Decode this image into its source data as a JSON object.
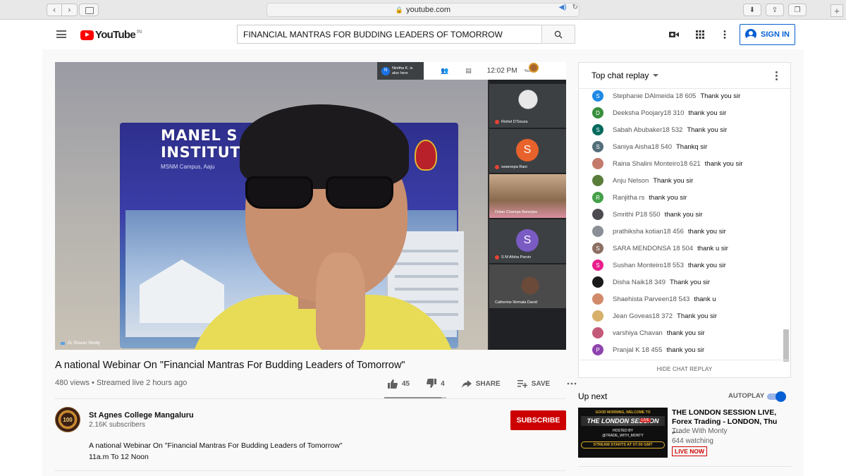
{
  "browser": {
    "url": "youtube.com"
  },
  "header": {
    "logo_text": "YouTube",
    "logo_country": "IN",
    "search_value": "FINANCIAL MANTRAS FOR BUDDING LEADERS OF TOMORROW",
    "signin_label": "SIGN IN"
  },
  "player": {
    "banner_line1": "MANEL S",
    "banner_line2": "INSTITUTE",
    "banner_sub": "MSNM Campus, Aaju",
    "speaker_name": "Dr Sharan Shetty",
    "meet": {
      "presence_initial": "N",
      "presence_text": "Ninitha K. is also here",
      "time": "12:02 PM",
      "you_label": "You"
    },
    "tiles": [
      {
        "name": "Rishel D'Souza",
        "initial": "",
        "color": ""
      },
      {
        "name": "swaroopa Rani",
        "initial": "S",
        "color": "#e8622c"
      },
      {
        "name": "Dolan Champa Banerjee",
        "initial": "",
        "color": ""
      },
      {
        "name": "S M Afsha Parvin",
        "initial": "S",
        "color": "#7a5bc4"
      },
      {
        "name": "Catherine Nirmala David",
        "initial": "",
        "color": ""
      }
    ]
  },
  "video": {
    "title": "A national Webinar On \"Financial Mantras For Budding Leaders of Tomorrow\"",
    "meta": "480 views • Streamed live 2 hours ago",
    "likes": "45",
    "dislikes": "4",
    "share_label": "SHARE",
    "save_label": "SAVE",
    "like_ratio": 0.92
  },
  "channel": {
    "name": "St Agnes College Mangaluru",
    "subscribers": "2.16K subscribers",
    "avatar_text": "100",
    "subscribe_label": "SUBSCRIBE",
    "description_line1": "A national Webinar On \"Financial Mantras For Budding Leaders of Tomorrow\"",
    "description_line2": "11a.m To 12 Noon"
  },
  "chat": {
    "header": "Top chat replay",
    "hide_label": "HIDE CHAT REPLAY",
    "messages": [
      {
        "initial": "S",
        "color": "#1e88e5",
        "author": "Stephanie DAlmeida 18 605",
        "text": "Thank you sir"
      },
      {
        "initial": "D",
        "color": "#388e3c",
        "author": "Deeksha Poojary18 310",
        "text": "thank you sir"
      },
      {
        "initial": "S",
        "color": "#00695c",
        "author": "Sabah Abubaker18 532",
        "text": "Thank you sir"
      },
      {
        "initial": "S",
        "color": "#546e7a",
        "author": "Saniya Aisha18 540",
        "text": "Thankq sir"
      },
      {
        "initial": "",
        "color": "#c47a6b",
        "author": "Raina Shalini Monteiro18 621",
        "text": "thank you sir"
      },
      {
        "initial": "",
        "color": "#5b7d3a",
        "author": "Anju Nelson",
        "text": "Thank you sir"
      },
      {
        "initial": "R",
        "color": "#43a047",
        "author": "Ranjitha rs",
        "text": "thank you sir"
      },
      {
        "initial": "",
        "color": "#4e4a52",
        "author": "Smrithi P18 550",
        "text": "thank you sir"
      },
      {
        "initial": "",
        "color": "#8a8f96",
        "author": "prathiksha kotian18 456",
        "text": "thank you sir"
      },
      {
        "initial": "S",
        "color": "#8d6e63",
        "author": "SARA MENDONSA 18 504",
        "text": "thank u sir"
      },
      {
        "initial": "S",
        "color": "#e91e8c",
        "author": "Sushan Monteiro18 553",
        "text": "thank you sir"
      },
      {
        "initial": "",
        "color": "#1a1a1a",
        "author": "Disha Naik18 349",
        "text": "Thank you sir"
      },
      {
        "initial": "",
        "color": "#d18a6a",
        "author": "Shaehista Parveen18 543",
        "text": "thank u"
      },
      {
        "initial": "",
        "color": "#d7b06a",
        "author": "Jean Goveas18 372",
        "text": "Thank you sir"
      },
      {
        "initial": "",
        "color": "#c45a7a",
        "author": "varshiya Chavan",
        "text": "thank you sir"
      },
      {
        "initial": "P",
        "color": "#8e44ad",
        "author": "Pranjal K 18 455",
        "text": "thank you sir"
      }
    ]
  },
  "upnext": {
    "label": "Up next",
    "autoplay_label": "AUTOPLAY",
    "video_title": "THE LONDON SESSION LIVE, Forex Trading - LONDON, Thu ,...",
    "channel": "Trade With Monty",
    "watching": "644 watching",
    "live_label": "LIVE NOW",
    "thumb_line1": "GOOD MORNING, WELCOME TO",
    "thumb_line2": "THE LONDON SESSION",
    "thumb_line3": "HOSTED BY",
    "thumb_line4": "@TRADE_WITH_MONTY",
    "thumb_line5": "STREAM STARTS AT 07:00 GMT",
    "thumb_live": "LIVE"
  },
  "colors": {
    "brand_red": "#ff0000",
    "subscribe_red": "#cc0000",
    "link_blue": "#065fd4"
  }
}
